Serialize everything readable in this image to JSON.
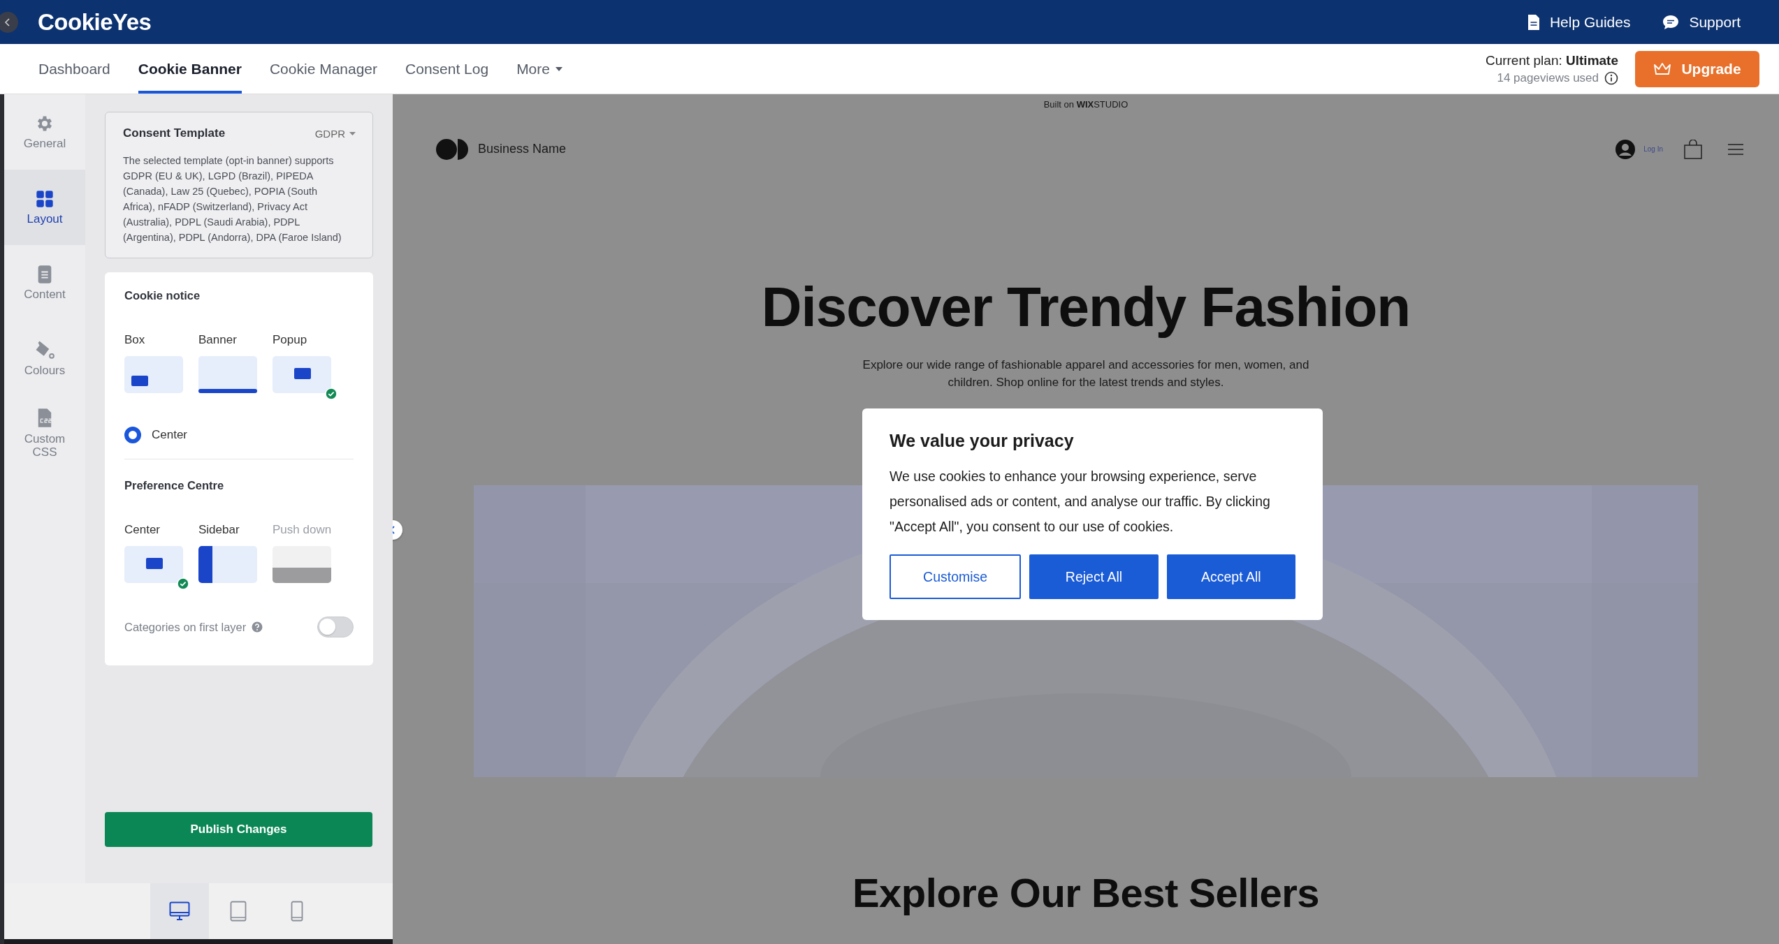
{
  "top_bar": {
    "logo": "CookieYes",
    "links": [
      {
        "label": "Help Guides",
        "kind": "guides"
      },
      {
        "label": "Support",
        "kind": "support"
      }
    ]
  },
  "nav": {
    "tabs": [
      {
        "label": "Dashboard",
        "selected": false,
        "kind": "link"
      },
      {
        "label": "Cookie Banner",
        "selected": true,
        "kind": "link"
      },
      {
        "label": "Cookie Manager",
        "selected": false,
        "kind": "link"
      },
      {
        "label": "Consent Log",
        "selected": false,
        "kind": "link"
      },
      {
        "label": "More",
        "selected": false,
        "kind": "dropdown"
      }
    ],
    "plan": "Current plan: **Ultimate**",
    "usage": "14 pageviews used",
    "upgrade_button": "Upgrade"
  },
  "rail": [
    {
      "label": "General",
      "kind": "gear",
      "selected": false
    },
    {
      "label": "Layout",
      "kind": "grid",
      "selected": true
    },
    {
      "label": "Content",
      "kind": "document",
      "selected": false
    },
    {
      "label": "Colours",
      "kind": "bucket",
      "selected": false
    },
    {
      "label": "Custom CSS",
      "kind": "css",
      "selected": false
    }
  ],
  "consent_template": {
    "title": "Consent Template",
    "region": "GDPR",
    "description": "The selected template (opt-in banner) supports GDPR (EU & UK), LGPD (Brazil), PIPEDA (Canada), Law 25 (Quebec), POPIA (South Africa), nFADP (Switzerland), Privacy Act (Australia), PDPL (Saudi Arabia), PDPL (Argentina), PDPL (Andorra), DPA (Faroe Island)"
  },
  "cookie_notice": {
    "title": "Cookie notice",
    "layouts": [
      {
        "label": "Box",
        "kind": "box",
        "selected": false,
        "disabled": false
      },
      {
        "label": "Banner",
        "kind": "banner",
        "selected": false,
        "disabled": false
      },
      {
        "label": "Popup",
        "kind": "popup",
        "selected": true,
        "disabled": false
      }
    ],
    "positions": [
      {
        "label": "Center",
        "selected": true
      }
    ]
  },
  "preference_centre": {
    "title": "Preference Centre",
    "layouts": [
      {
        "label": "Center",
        "kind": "center",
        "selected": true,
        "disabled": false
      },
      {
        "label": "Sidebar",
        "kind": "sidebar",
        "selected": false,
        "disabled": false
      },
      {
        "label": "Push down",
        "kind": "pushdown",
        "selected": false,
        "disabled": true
      }
    ],
    "categories_toggle": {
      "label": "Categories on first layer",
      "on": false
    }
  },
  "publish_button": "Publish Changes",
  "devices": [
    {
      "kind": "desktop",
      "selected": true
    },
    {
      "kind": "tablet",
      "selected": false
    },
    {
      "kind": "mobile",
      "selected": false
    }
  ],
  "preview": {
    "wix_bar": "Built on **WIX**STUDIO",
    "site_name": "Business Name",
    "login": "Log In",
    "hero_title": "Discover Trendy Fashion",
    "hero_text": "Explore our wide range of fashionable apparel and accessories for men, women, and children. Shop online for the latest trends and styles.",
    "section_title": "Explore Our Best Sellers"
  },
  "consent_banner": {
    "title": "We value your privacy",
    "message": "We use cookies to enhance your browsing experience, serve personalised ads or content, and analyse our traffic. By clicking \"Accept All\", you consent to our use of cookies.",
    "buttons": [
      {
        "label": "Customise",
        "kind": "outline"
      },
      {
        "label": "Reject All",
        "kind": "primary"
      },
      {
        "label": "Accept All",
        "kind": "primary"
      }
    ]
  }
}
